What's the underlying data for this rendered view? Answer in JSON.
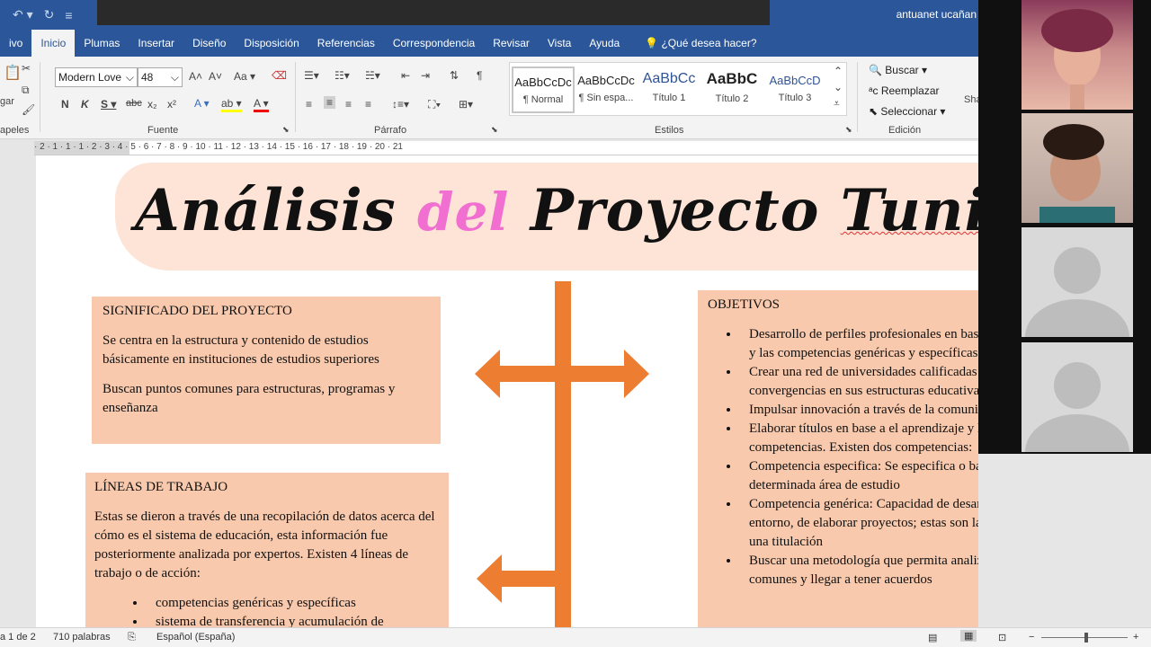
{
  "titlebar": {
    "user": "antuanet ucañan"
  },
  "tabs": [
    {
      "label": "ivo",
      "active": false
    },
    {
      "label": "Inicio",
      "active": true
    },
    {
      "label": "Plumas",
      "active": false
    },
    {
      "label": "Insertar",
      "active": false
    },
    {
      "label": "Diseño",
      "active": false
    },
    {
      "label": "Disposición",
      "active": false
    },
    {
      "label": "Referencias",
      "active": false
    },
    {
      "label": "Correspondencia",
      "active": false
    },
    {
      "label": "Revisar",
      "active": false
    },
    {
      "label": "Vista",
      "active": false
    },
    {
      "label": "Ayuda",
      "active": false
    }
  ],
  "tell_me": "¿Qué desea hacer?",
  "ribbon": {
    "font_name": "Modern Love",
    "font_size": "48",
    "groups": {
      "clipboard": "apeles",
      "font": "Fuente",
      "paragraph": "Párrafo",
      "styles": "Estilos",
      "editing": "Edición"
    },
    "paste_label": "gar",
    "styles": [
      {
        "preview": "AaBbCcDc",
        "name": "¶ Normal"
      },
      {
        "preview": "AaBbCcDc",
        "name": "¶ Sin espa..."
      },
      {
        "preview": "AaBbCc",
        "name": "Título 1"
      },
      {
        "preview": "AaBbC",
        "name": "Título 2"
      },
      {
        "preview": "AaBbCcD",
        "name": "Título 3"
      }
    ],
    "editing": {
      "find": "Buscar",
      "replace": "Reemplazar",
      "select": "Seleccionar"
    },
    "share": "Sha"
  },
  "ruler": "· 2 · 1 · 1 · 1 · 2 · 3 · 4 · 5 · 6 · 7 · 8 · 9 · 10 · 11 · 12 · 13 · 14 · 15 · 16 · 17 · 18 · 19 · 20 · 21",
  "document": {
    "title_1": "Análisis",
    "title_2": "del",
    "title_3": "Proyecto",
    "title_4": "Tunin",
    "significado": {
      "heading": "SIGNIFICADO DEL PROYECTO",
      "p1": "Se centra en la estructura y contenido de estudios básicamente en instituciones de estudios superiores",
      "p2": "Buscan puntos comunes para estructuras, programas y enseñanza"
    },
    "lineas": {
      "heading": "LÍNEAS DE TRABAJO",
      "p1": "Estas se dieron a través de una recopilación de datos acerca del cómo es el sistema de educación, esta información fue posteriormente analizada por expertos. Existen 4 líneas de trabajo o de acción:",
      "items": [
        "competencias genéricas y específicas",
        "sistema de transferencia y acumulación de"
      ]
    },
    "objetivos": {
      "heading": "OBJETIVOS",
      "items": [
        "Desarrollo de perfiles profesionales en base al aprendizaje y las competencias genéricas y específicas",
        "Crear una red de universidades calificadas para generar convergencias en sus estructuras educativas",
        "Impulsar innovación a través de la comunicación",
        "Elaborar títulos en base a el aprendizaje y las competencias. Existen dos competencias:",
        "Competencia especifica: Se especifica o basa en una determinada área de estudio",
        "Competencia genérica: Capacidad de desarrollarse en un entorno, de elaborar proyectos; estas son las comunes en una titulación",
        "Buscar una metodología que permita analizar los puntos comunes y llegar a tener acuerdos"
      ]
    }
  },
  "status": {
    "page": "a 1 de 2",
    "words": "710 palabras",
    "language": "Español (España)"
  },
  "colors": {
    "word_blue": "#2b579a",
    "box_fill": "#f8c9ac",
    "arrow": "#ed7d31",
    "banner": "#fde4d6"
  }
}
